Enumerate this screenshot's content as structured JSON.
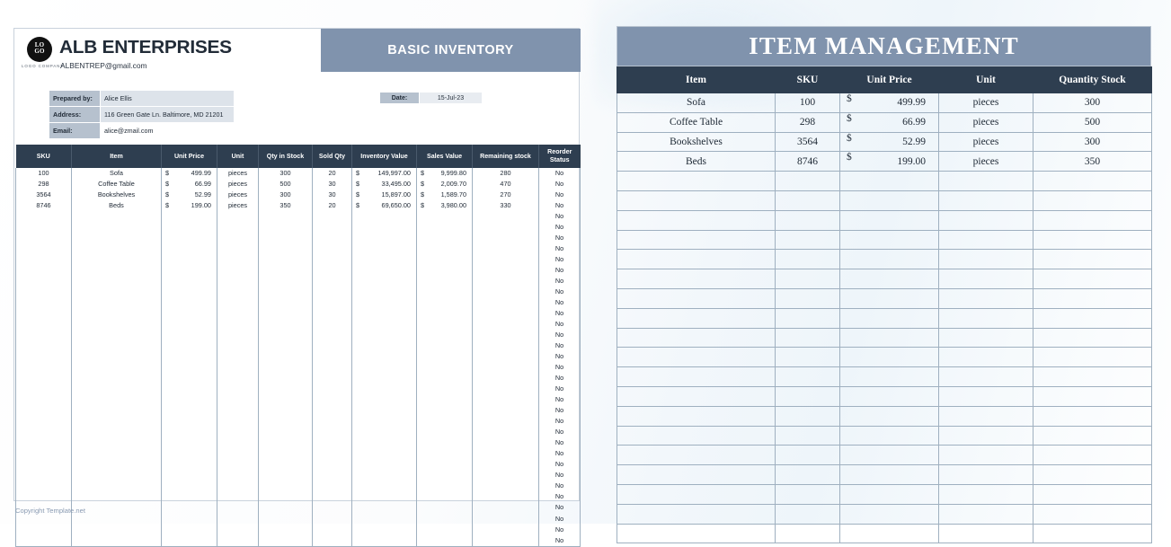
{
  "left_sheet": {
    "brand": {
      "logo_text_line1": "LO",
      "logo_text_line2": "GO",
      "logo_caption": "LOGO COMPANY",
      "company_name": "ALB ENTERPRISES",
      "company_email": "ALBENTREP@gmail.com",
      "logo_icon": "circular-logo-badge"
    },
    "title": "BASIC INVENTORY",
    "info": {
      "rows": [
        {
          "label": "Prepared by:",
          "value": "Alice Ellis"
        },
        {
          "label": "Address:",
          "value": "116 Green Gate Ln. Baltimore, MD 21201"
        },
        {
          "label": "Email:",
          "value": "alice@zmail.com"
        }
      ]
    },
    "date": {
      "label": "Date:",
      "value": "15-Jul-23"
    },
    "table": {
      "columns": [
        "SKU",
        "Item",
        "Unit Price",
        "Unit",
        "Qty in Stock",
        "Sold Qty",
        "Inventory Value",
        "Sales Value",
        "Remaining stock",
        "Reorder Status"
      ],
      "rows": [
        {
          "sku": "100",
          "item": "Sofa",
          "currency": "$",
          "unit_price": "499.99",
          "unit": "pieces",
          "qty_in_stock": "300",
          "sold_qty": "20",
          "inventory_value": "149,997.00",
          "sales_value": "9,999.80",
          "remaining_stock": "280",
          "reorder_status": "No"
        },
        {
          "sku": "298",
          "item": "Coffee Table",
          "currency": "$",
          "unit_price": "66.99",
          "unit": "pieces",
          "qty_in_stock": "500",
          "sold_qty": "30",
          "inventory_value": "33,495.00",
          "sales_value": "2,009.70",
          "remaining_stock": "470",
          "reorder_status": "No"
        },
        {
          "sku": "3564",
          "item": "Bookshelves",
          "currency": "$",
          "unit_price": "52.99",
          "unit": "pieces",
          "qty_in_stock": "300",
          "sold_qty": "30",
          "inventory_value": "15,897.00",
          "sales_value": "1,589.70",
          "remaining_stock": "270",
          "reorder_status": "No"
        },
        {
          "sku": "8746",
          "item": "Beds",
          "currency": "$",
          "unit_price": "199.00",
          "unit": "pieces",
          "qty_in_stock": "350",
          "sold_qty": "20",
          "inventory_value": "69,650.00",
          "sales_value": "3,980.00",
          "remaining_stock": "330",
          "reorder_status": "No"
        }
      ],
      "empty_row_count": 31,
      "empty_row_reorder_status": "No"
    },
    "footer": "Copyright Template.net"
  },
  "right_sheet": {
    "title": "ITEM MANAGEMENT",
    "table": {
      "columns": [
        "Item",
        "SKU",
        "Unit Price",
        "Unit",
        "Quantity Stock"
      ],
      "rows": [
        {
          "item": "Sofa",
          "sku": "100",
          "currency": "$",
          "unit_price": "499.99",
          "unit": "pieces",
          "quantity_stock": "300"
        },
        {
          "item": "Coffee Table",
          "sku": "298",
          "currency": "$",
          "unit_price": "66.99",
          "unit": "pieces",
          "quantity_stock": "500"
        },
        {
          "item": "Bookshelves",
          "sku": "3564",
          "currency": "$",
          "unit_price": "52.99",
          "unit": "pieces",
          "quantity_stock": "300"
        },
        {
          "item": "Beds",
          "sku": "8746",
          "currency": "$",
          "unit_price": "199.00",
          "unit": "pieces",
          "quantity_stock": "350"
        }
      ],
      "empty_row_count": 19
    }
  },
  "colors": {
    "header_bar": "#8093ad",
    "table_header": "#2e3e50",
    "grid_line": "#9fb0c0",
    "label_cell": "#b6c1ce",
    "value_cell": "#dde3ea",
    "footer_text": "#8a9bb2"
  }
}
